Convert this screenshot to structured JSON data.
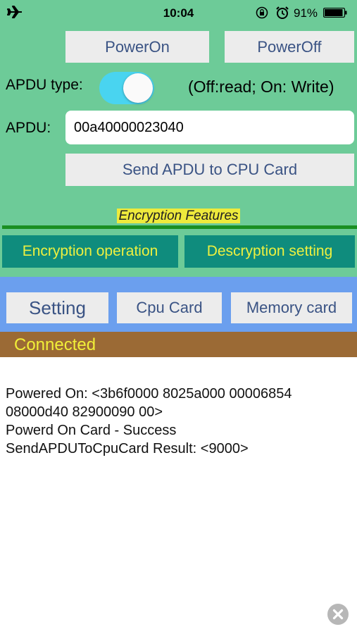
{
  "status_bar": {
    "time": "10:04",
    "battery_percent": "91%",
    "icons": [
      "airplane-icon",
      "rotation-lock-icon",
      "alarm-icon",
      "battery-icon"
    ]
  },
  "controls": {
    "power_on_label": "PowerOn",
    "power_off_label": "PowerOff",
    "apdu_type_label": "APDU type:",
    "apdu_type_toggle_on": true,
    "apdu_type_hint": "(Off:read; On: Write)",
    "apdu_label": "APDU:",
    "apdu_value": "00a40000023040",
    "send_label": "Send APDU to CPU Card"
  },
  "encryption": {
    "title": "Encryption Features",
    "operation_label": "Encryption operation",
    "setting_label": "Descryption setting"
  },
  "tabs": [
    {
      "label": "Setting"
    },
    {
      "label": "Cpu Card"
    },
    {
      "label": "Memory card"
    }
  ],
  "connection": {
    "status": "Connected"
  },
  "log": [
    "Powered On: <3b6f0000 8025a000 00006854",
    "08000d40 82900090 00>",
    "Powerd On Card - Success",
    "SendAPDUToCpuCard Result: <9000>"
  ],
  "colors": {
    "panel_green": "#6dcb98",
    "toggle_on": "#49d4f0",
    "teal_button": "#0f8c7d",
    "yellow_text": "#eef03f",
    "tab_bar_blue": "#6b9fee",
    "connection_bar": "#9b6a35",
    "button_text": "#3a5384"
  }
}
